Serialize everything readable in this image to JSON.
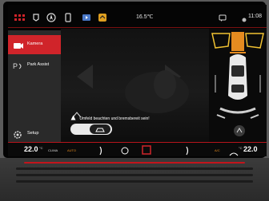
{
  "status_bar": {
    "temperature_outside": "16.5℃",
    "time": "11:08",
    "icons": [
      "apps-icon",
      "mirror-icon",
      "navigation-icon",
      "phone-icon",
      "media-icon",
      "settings-icon",
      "message-icon",
      "dot-icon"
    ]
  },
  "sidebar": {
    "items": [
      {
        "label": "Kamera",
        "icon": "camera-icon",
        "active": true
      },
      {
        "label": "Park Assist",
        "icon": "park-assist-icon",
        "active": false
      },
      {
        "label": "Setup",
        "icon": "gear-icon",
        "active": false
      }
    ]
  },
  "camera": {
    "warning": "Umfeld beachten und bremsbereit sein!",
    "left_icon": "park-sensor-icon"
  },
  "climate": {
    "temp_left": "22.0",
    "temp_right": "22.0",
    "left_label": "CLIMA",
    "auto_label": "AUTO",
    "ac_label": "A/C",
    "temp_left_unit": "°C",
    "temp_right_unit": "°C"
  },
  "colors": {
    "accent_red": "#d0242a",
    "sensor_orange": "#e58b20",
    "sensor_yellow": "#f1c232"
  }
}
